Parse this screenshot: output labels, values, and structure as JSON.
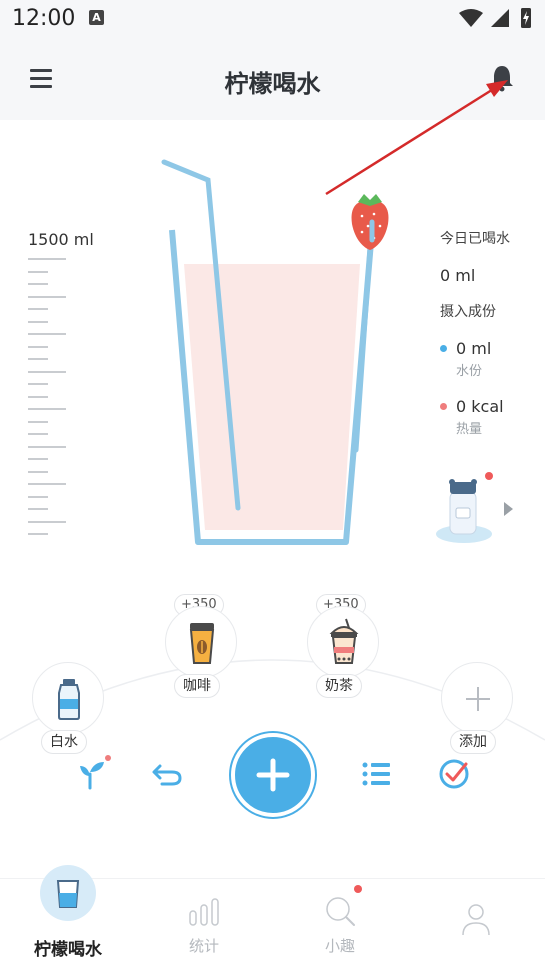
{
  "status_bar": {
    "time": "12:00",
    "notification_icon": "A"
  },
  "app_bar": {
    "title": "柠檬喝水",
    "menu_icon": "hamburger-menu-icon",
    "bell_icon": "bell-icon"
  },
  "glass": {
    "capacity_label": "1500 ml",
    "fill_fraction": 0,
    "colors": {
      "glass_outline": "#8ec7e6",
      "liquid_tint": "#fbe8e6",
      "straw": "#8ec7e6"
    }
  },
  "today": {
    "label": "今日已喝水",
    "value": "0 ml",
    "intake_label": "摄入成份",
    "water": {
      "value": "0 ml",
      "name": "水份",
      "color": "#4aaee6"
    },
    "calories": {
      "value": "0 kcal",
      "name": "热量",
      "color": "#ef7d7d"
    }
  },
  "drinks": [
    {
      "name": "白水",
      "plus": "",
      "icon": "water-bottle-icon"
    },
    {
      "name": "咖啡",
      "plus": "+350",
      "icon": "coffee-cup-icon"
    },
    {
      "name": "奶茶",
      "plus": "+350",
      "icon": "milk-tea-icon"
    },
    {
      "name": "添加",
      "plus": "",
      "icon": "add-icon"
    }
  ],
  "actions": {
    "plant": "plant-icon",
    "undo": "undo-icon",
    "add": "add-drink-icon",
    "list": "list-icon",
    "check": "check-circle-icon"
  },
  "bottom_nav": [
    {
      "label": "柠檬喝水",
      "icon": "water-glass-icon",
      "active": true
    },
    {
      "label": "统计",
      "icon": "bar-chart-icon",
      "active": false
    },
    {
      "label": "小趣",
      "icon": "search-icon",
      "active": false
    },
    {
      "label": "",
      "icon": "profile-icon",
      "active": false
    }
  ],
  "accent_color": "#4aaee6"
}
